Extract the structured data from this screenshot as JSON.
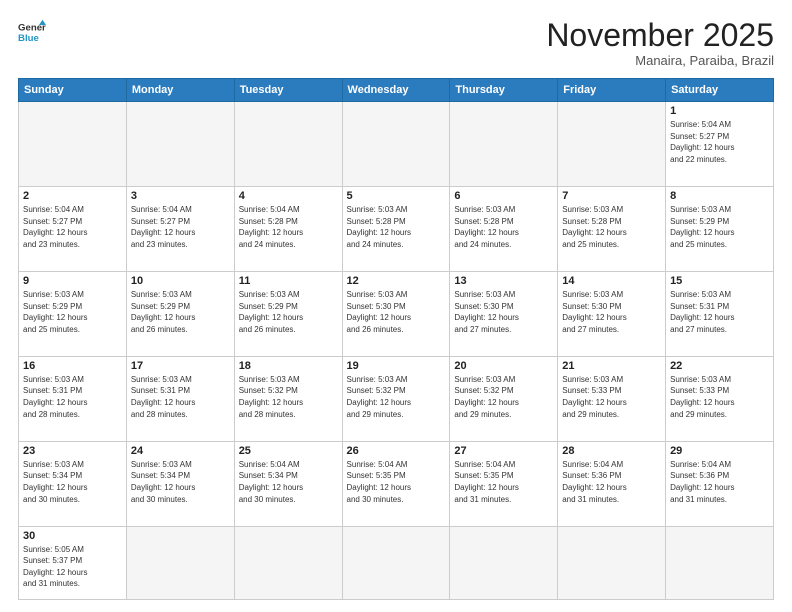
{
  "header": {
    "logo_general": "General",
    "logo_blue": "Blue",
    "month_title": "November 2025",
    "location": "Manaira, Paraiba, Brazil"
  },
  "weekdays": [
    "Sunday",
    "Monday",
    "Tuesday",
    "Wednesday",
    "Thursday",
    "Friday",
    "Saturday"
  ],
  "weeks": [
    [
      {
        "day": "",
        "info": ""
      },
      {
        "day": "",
        "info": ""
      },
      {
        "day": "",
        "info": ""
      },
      {
        "day": "",
        "info": ""
      },
      {
        "day": "",
        "info": ""
      },
      {
        "day": "",
        "info": ""
      },
      {
        "day": "1",
        "info": "Sunrise: 5:04 AM\nSunset: 5:27 PM\nDaylight: 12 hours\nand 22 minutes."
      }
    ],
    [
      {
        "day": "2",
        "info": "Sunrise: 5:04 AM\nSunset: 5:27 PM\nDaylight: 12 hours\nand 23 minutes."
      },
      {
        "day": "3",
        "info": "Sunrise: 5:04 AM\nSunset: 5:27 PM\nDaylight: 12 hours\nand 23 minutes."
      },
      {
        "day": "4",
        "info": "Sunrise: 5:04 AM\nSunset: 5:28 PM\nDaylight: 12 hours\nand 24 minutes."
      },
      {
        "day": "5",
        "info": "Sunrise: 5:03 AM\nSunset: 5:28 PM\nDaylight: 12 hours\nand 24 minutes."
      },
      {
        "day": "6",
        "info": "Sunrise: 5:03 AM\nSunset: 5:28 PM\nDaylight: 12 hours\nand 24 minutes."
      },
      {
        "day": "7",
        "info": "Sunrise: 5:03 AM\nSunset: 5:28 PM\nDaylight: 12 hours\nand 25 minutes."
      },
      {
        "day": "8",
        "info": "Sunrise: 5:03 AM\nSunset: 5:29 PM\nDaylight: 12 hours\nand 25 minutes."
      }
    ],
    [
      {
        "day": "9",
        "info": "Sunrise: 5:03 AM\nSunset: 5:29 PM\nDaylight: 12 hours\nand 25 minutes."
      },
      {
        "day": "10",
        "info": "Sunrise: 5:03 AM\nSunset: 5:29 PM\nDaylight: 12 hours\nand 26 minutes."
      },
      {
        "day": "11",
        "info": "Sunrise: 5:03 AM\nSunset: 5:29 PM\nDaylight: 12 hours\nand 26 minutes."
      },
      {
        "day": "12",
        "info": "Sunrise: 5:03 AM\nSunset: 5:30 PM\nDaylight: 12 hours\nand 26 minutes."
      },
      {
        "day": "13",
        "info": "Sunrise: 5:03 AM\nSunset: 5:30 PM\nDaylight: 12 hours\nand 27 minutes."
      },
      {
        "day": "14",
        "info": "Sunrise: 5:03 AM\nSunset: 5:30 PM\nDaylight: 12 hours\nand 27 minutes."
      },
      {
        "day": "15",
        "info": "Sunrise: 5:03 AM\nSunset: 5:31 PM\nDaylight: 12 hours\nand 27 minutes."
      }
    ],
    [
      {
        "day": "16",
        "info": "Sunrise: 5:03 AM\nSunset: 5:31 PM\nDaylight: 12 hours\nand 28 minutes."
      },
      {
        "day": "17",
        "info": "Sunrise: 5:03 AM\nSunset: 5:31 PM\nDaylight: 12 hours\nand 28 minutes."
      },
      {
        "day": "18",
        "info": "Sunrise: 5:03 AM\nSunset: 5:32 PM\nDaylight: 12 hours\nand 28 minutes."
      },
      {
        "day": "19",
        "info": "Sunrise: 5:03 AM\nSunset: 5:32 PM\nDaylight: 12 hours\nand 29 minutes."
      },
      {
        "day": "20",
        "info": "Sunrise: 5:03 AM\nSunset: 5:32 PM\nDaylight: 12 hours\nand 29 minutes."
      },
      {
        "day": "21",
        "info": "Sunrise: 5:03 AM\nSunset: 5:33 PM\nDaylight: 12 hours\nand 29 minutes."
      },
      {
        "day": "22",
        "info": "Sunrise: 5:03 AM\nSunset: 5:33 PM\nDaylight: 12 hours\nand 29 minutes."
      }
    ],
    [
      {
        "day": "23",
        "info": "Sunrise: 5:03 AM\nSunset: 5:34 PM\nDaylight: 12 hours\nand 30 minutes."
      },
      {
        "day": "24",
        "info": "Sunrise: 5:03 AM\nSunset: 5:34 PM\nDaylight: 12 hours\nand 30 minutes."
      },
      {
        "day": "25",
        "info": "Sunrise: 5:04 AM\nSunset: 5:34 PM\nDaylight: 12 hours\nand 30 minutes."
      },
      {
        "day": "26",
        "info": "Sunrise: 5:04 AM\nSunset: 5:35 PM\nDaylight: 12 hours\nand 30 minutes."
      },
      {
        "day": "27",
        "info": "Sunrise: 5:04 AM\nSunset: 5:35 PM\nDaylight: 12 hours\nand 31 minutes."
      },
      {
        "day": "28",
        "info": "Sunrise: 5:04 AM\nSunset: 5:36 PM\nDaylight: 12 hours\nand 31 minutes."
      },
      {
        "day": "29",
        "info": "Sunrise: 5:04 AM\nSunset: 5:36 PM\nDaylight: 12 hours\nand 31 minutes."
      }
    ],
    [
      {
        "day": "30",
        "info": "Sunrise: 5:05 AM\nSunset: 5:37 PM\nDaylight: 12 hours\nand 31 minutes."
      },
      {
        "day": "",
        "info": ""
      },
      {
        "day": "",
        "info": ""
      },
      {
        "day": "",
        "info": ""
      },
      {
        "day": "",
        "info": ""
      },
      {
        "day": "",
        "info": ""
      },
      {
        "day": "",
        "info": ""
      }
    ]
  ]
}
